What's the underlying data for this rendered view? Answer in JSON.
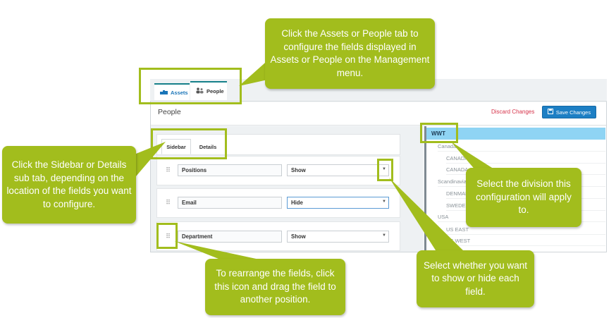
{
  "app": {
    "tabs": [
      {
        "label": "Assets",
        "icon": "boxes-icon"
      },
      {
        "label": "People",
        "icon": "people-icon"
      }
    ],
    "page_title": "People",
    "discard_label": "Discard Changes",
    "save_label": "Save Changes",
    "sub_tabs": [
      {
        "label": "Sidebar",
        "active": true
      },
      {
        "label": "Details",
        "active": false
      }
    ],
    "fields": [
      {
        "name": "Positions",
        "visibility": "Show"
      },
      {
        "name": "Email",
        "visibility": "Hide"
      },
      {
        "name": "Department",
        "visibility": "Show"
      }
    ],
    "tree": {
      "selected": "WWT",
      "nodes": [
        {
          "label": "Canada",
          "level": 1
        },
        {
          "label": "CANADA",
          "level": 2
        },
        {
          "label": "CANADA",
          "level": 2
        },
        {
          "label": "Scandinavia",
          "level": 1
        },
        {
          "label": "DENMARK",
          "level": 2
        },
        {
          "label": "SWEDEN",
          "level": 2
        },
        {
          "label": "USA",
          "level": 1
        },
        {
          "label": "US EAST",
          "level": 2
        },
        {
          "label": "US WEST",
          "level": 2
        }
      ]
    }
  },
  "callouts": {
    "tabs": "Click the Assets or People tab to configure the fields displayed in Assets or People on the Management menu.",
    "subtabs": "Click the Sidebar or Details sub tab, depending on the location of the fields you want to configure.",
    "division": "Select the division this configuration will apply to.",
    "showhide": "Select whether you want to show or hide each field.",
    "rearrange": "To rearrange the fields, click this icon and drag the field to another position."
  },
  "colors": {
    "callout_green": "#a2bd1d",
    "save_blue": "#1d7fc4",
    "discard_red": "#d6334a",
    "tree_selected": "#8fd4f4"
  }
}
